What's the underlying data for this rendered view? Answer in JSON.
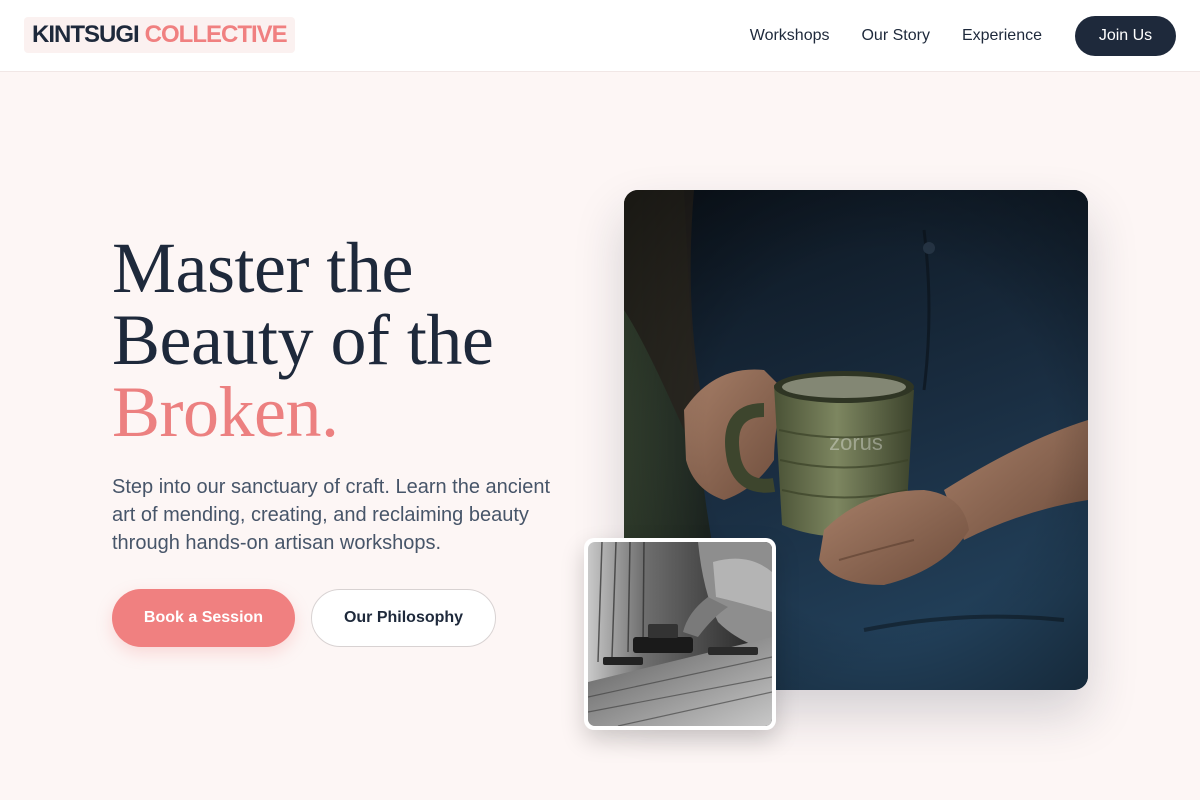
{
  "header": {
    "logo_primary": "KINTSUGI",
    "logo_accent": "COLLECTIVE",
    "nav": [
      "Workshops",
      "Our Story",
      "Experience"
    ],
    "cta": "Join Us"
  },
  "hero": {
    "title_line1": "Master the",
    "title_line2": "Beauty of the",
    "title_accent": "Broken.",
    "description": "Step into our sanctuary of craft. Learn the ancient art of mending, creating, and reclaiming beauty through hands-on artisan workshops.",
    "primary_button": "Book a Session",
    "secondary_button": "Our Philosophy"
  },
  "images": {
    "main_photo": "hands-holding-ceramic-mug-photo",
    "main_photo_watermark": "zorus",
    "inset_photo": "woodworker-at-workbench-photo"
  },
  "colors": {
    "accent": "#f08080",
    "dark": "#1e293b",
    "background": "#fdf6f5"
  }
}
